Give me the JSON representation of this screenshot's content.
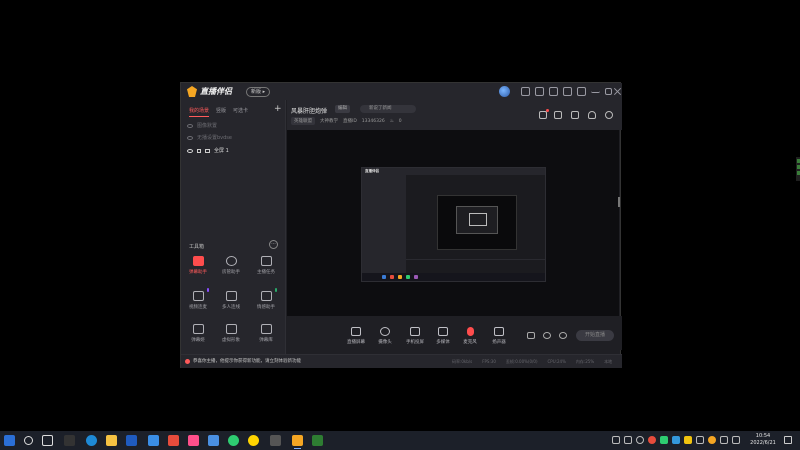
{
  "app": {
    "name": "直播伴侣",
    "version_badge": "新版 ▸",
    "scene_tabs": [
      "我的场景",
      "竖版",
      "可选卡"
    ],
    "sources": [
      {
        "label": "图像默置",
        "enabled": false
      },
      {
        "label": "无播设置bvdse",
        "enabled": false
      },
      {
        "label": "全屏 1",
        "enabled": true
      }
    ],
    "tools_title": "工具箱",
    "tools": [
      {
        "label": "弹幕助手",
        "active": true
      },
      {
        "label": "房管助手",
        "active": false
      },
      {
        "label": "主播任务",
        "active": false
      },
      {
        "label": "视频连麦",
        "active": false
      },
      {
        "label": "多人连线",
        "active": false
      },
      {
        "label": "情感助手",
        "active": false
      },
      {
        "label": "弹幕姬",
        "active": false
      },
      {
        "label": "虚拟形象",
        "active": false
      },
      {
        "label": "弹幕库",
        "active": false
      }
    ],
    "header": {
      "room_name": "风暴肝胆炮弹",
      "edit_label": "编辑",
      "announcement": "新说了新闻",
      "category": "英雄联盟",
      "tag": "大神教学",
      "room_id_label": "直播ID",
      "room_id": "13346326",
      "heat": "0"
    },
    "bottom_tools": [
      "直播屏幕",
      "摄像头",
      "手机投屏",
      "多媒体",
      "麦克风",
      "扬声器"
    ],
    "go_live": "开始直播",
    "notice": "恭喜你主播，他提示你获得新功能，请立刻体验新功能",
    "stats": [
      "码率:0kb/s",
      "FPS:30",
      "丢帧:0.00%(0/0)",
      "CPU:24%",
      "内存:25%",
      "本地"
    ]
  },
  "taskbar": {
    "time": "10:54",
    "date": "2022/6/21"
  },
  "colors": {
    "accent": "#ff4d4d",
    "panel": "#26262c",
    "background": "#1f1f24"
  }
}
